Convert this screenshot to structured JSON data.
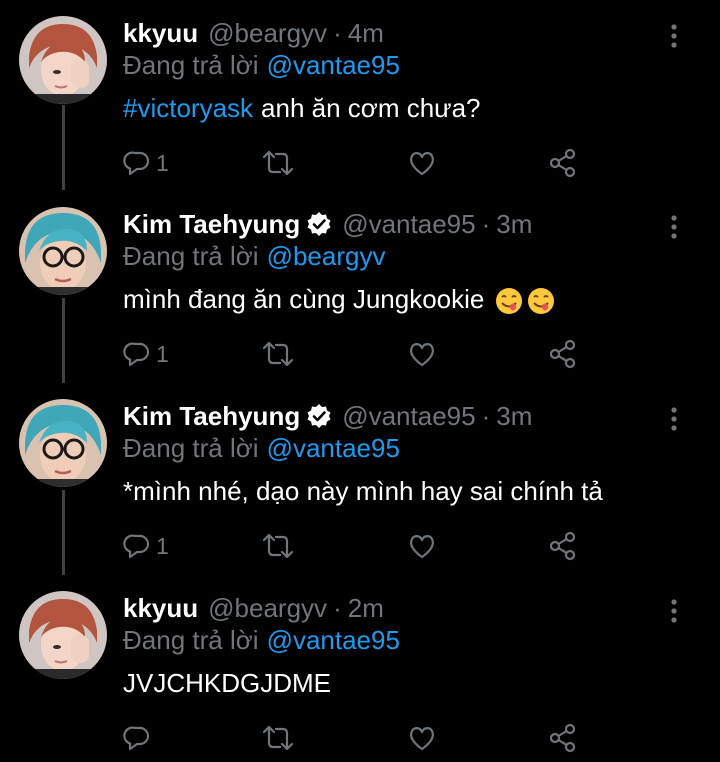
{
  "tweets": [
    {
      "name": "kkyuu",
      "handle": "@beargyv",
      "dot": "·",
      "time": "4m",
      "reply_prefix": "Đang trả lời",
      "reply_to": "@vantae95",
      "hashtag": "#victoryask",
      "text": "anh ăn cơm chưa?",
      "reply_count": "1",
      "verified": false
    },
    {
      "name": "Kim Taehyung",
      "handle": "@vantae95",
      "dot": "·",
      "time": "3m",
      "reply_prefix": "Đang trả lời",
      "reply_to": "@beargyv",
      "text": "mình đang ăn cùng Jungkookie",
      "emoji": [
        "face-savoring-food-icon",
        "face-savoring-food-icon"
      ],
      "reply_count": "1",
      "verified": true
    },
    {
      "name": "Kim Taehyung",
      "handle": "@vantae95",
      "dot": "·",
      "time": "3m",
      "reply_prefix": "Đang trả lời",
      "reply_to": "@vantae95",
      "text": "*mình nhé, dạo này mình hay sai chính tả",
      "reply_count": "1",
      "verified": true
    },
    {
      "name": "kkyuu",
      "handle": "@beargyv",
      "dot": "·",
      "time": "2m",
      "reply_prefix": "Đang trả lời",
      "reply_to": "@vantae95",
      "text": "JVJCHKDGJDME",
      "reply_count": "",
      "verified": false
    }
  ],
  "colors": {
    "background": "#000000",
    "text": "#ffffff",
    "muted": "#71767b",
    "link": "#1d9bf0",
    "thread_line": "#3d4247"
  }
}
